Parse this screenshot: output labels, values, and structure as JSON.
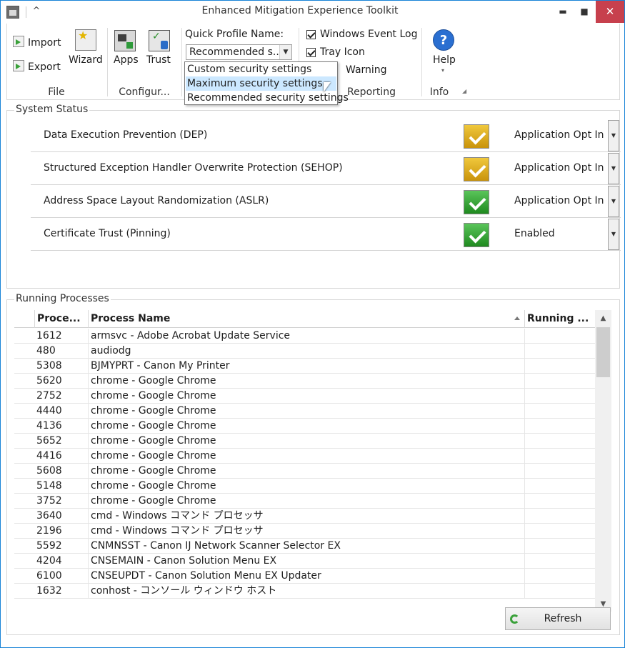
{
  "window": {
    "title": "Enhanced Mitigation Experience Toolkit",
    "collapse_glyph": "^",
    "min_glyph": "▬",
    "max_glyph": "■",
    "close_glyph": "✕"
  },
  "ribbon": {
    "file": {
      "import": "Import",
      "export": "Export",
      "wizard": "Wizard",
      "label": "File"
    },
    "configure": {
      "apps": "Apps",
      "trust": "Trust",
      "label": "Configur..."
    },
    "quick_profile": {
      "label": "Quick Profile Name:",
      "value": "Recommended s...",
      "options": [
        "Custom security settings",
        "Maximum security settings",
        "Recommended security settings"
      ],
      "highlighted": "Maximum security settings"
    },
    "reporting": {
      "windows_event_log": "Windows Event Log",
      "tray_icon": "Tray Icon",
      "early_warning": "Warning",
      "label": "Reporting"
    },
    "info": {
      "help": "Help",
      "help_more": "▾",
      "label": "Info",
      "launcher": "◢"
    }
  },
  "system_status": {
    "title": "System Status",
    "rows": [
      {
        "label": "Data Execution Prevention (DEP)",
        "value": "Application Opt In",
        "color": "yellow"
      },
      {
        "label": "Structured Exception Handler Overwrite Protection (SEHOP)",
        "value": "Application Opt In",
        "color": "yellow"
      },
      {
        "label": "Address Space Layout Randomization (ASLR)",
        "value": "Application Opt In",
        "color": "green"
      },
      {
        "label": "Certificate Trust (Pinning)",
        "value": "Enabled",
        "color": "green"
      }
    ]
  },
  "running_processes": {
    "title": "Running Processes",
    "columns": {
      "pid": "Proce...",
      "name": "Process Name",
      "running": "Running ..."
    },
    "rows": [
      {
        "pid": "1612",
        "name": "armsvc - Adobe Acrobat Update Service"
      },
      {
        "pid": "480",
        "name": "audiodg"
      },
      {
        "pid": "5308",
        "name": "BJMYPRT - Canon My Printer"
      },
      {
        "pid": "5620",
        "name": "chrome - Google Chrome"
      },
      {
        "pid": "2752",
        "name": "chrome - Google Chrome"
      },
      {
        "pid": "4440",
        "name": "chrome - Google Chrome"
      },
      {
        "pid": "4136",
        "name": "chrome - Google Chrome"
      },
      {
        "pid": "5652",
        "name": "chrome - Google Chrome"
      },
      {
        "pid": "4416",
        "name": "chrome - Google Chrome"
      },
      {
        "pid": "5608",
        "name": "chrome - Google Chrome"
      },
      {
        "pid": "5148",
        "name": "chrome - Google Chrome"
      },
      {
        "pid": "3752",
        "name": "chrome - Google Chrome"
      },
      {
        "pid": "3640",
        "name": "cmd - Windows コマンド プロセッサ"
      },
      {
        "pid": "2196",
        "name": "cmd - Windows コマンド プロセッサ"
      },
      {
        "pid": "5592",
        "name": "CNMNSST - Canon IJ Network Scanner Selector EX"
      },
      {
        "pid": "4204",
        "name": "CNSEMAIN - Canon Solution Menu EX"
      },
      {
        "pid": "6100",
        "name": "CNSEUPDT - Canon Solution Menu EX Updater"
      },
      {
        "pid": "1632",
        "name": "conhost - コンソール ウィンドウ ホスト"
      }
    ],
    "refresh_label": "Refresh"
  },
  "colors": {
    "accent_border": "#1883d7",
    "close_red": "#c7404d",
    "highlight": "#cce8ff"
  }
}
